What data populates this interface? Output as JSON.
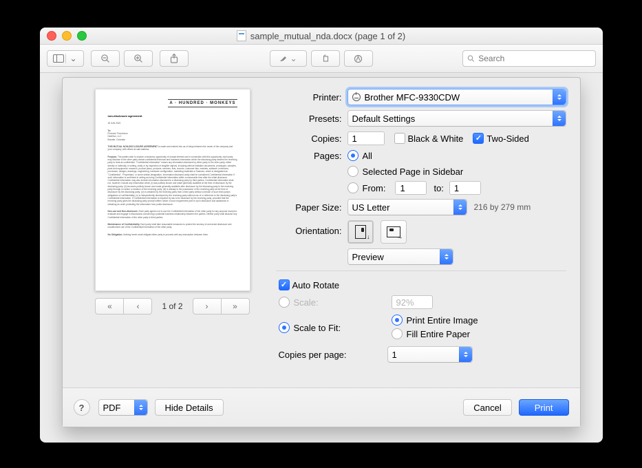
{
  "window": {
    "title": "sample_mutual_nda.docx (page 1 of 2)"
  },
  "toolbar": {
    "search_placeholder": "Search"
  },
  "preview": {
    "page_label": "1 of 2"
  },
  "form": {
    "printer_label": "Printer:",
    "printer_value": "Brother MFC-9330CDW",
    "presets_label": "Presets:",
    "presets_value": "Default Settings",
    "copies_label": "Copies:",
    "copies_value": "1",
    "bw_label": "Black & White",
    "bw_checked": false,
    "twosided_label": "Two-Sided",
    "twosided_checked": true,
    "pages_label": "Pages:",
    "pages_all": "All",
    "pages_selected": "Selected Page in Sidebar",
    "pages_from": "From:",
    "pages_from_value": "1",
    "pages_to": "to:",
    "pages_to_value": "1",
    "pages_mode": "all",
    "paper_size_label": "Paper Size:",
    "paper_size_value": "US Letter",
    "paper_dims": "216 by 279 mm",
    "orientation_label": "Orientation:",
    "orientation": "portrait",
    "section_value": "Preview",
    "auto_rotate_label": "Auto Rotate",
    "auto_rotate_checked": true,
    "scale_label": "Scale:",
    "scale_value": "92%",
    "scaletofit_label": "Scale to Fit:",
    "scale_mode": "fit",
    "print_entire": "Print Entire Image",
    "fill_paper": "Fill Entire Paper",
    "fit_mode": "print_entire",
    "copies_per_page_label": "Copies per page:",
    "copies_per_page_value": "1"
  },
  "footer": {
    "pdf_label": "PDF",
    "hide_details": "Hide Details",
    "cancel": "Cancel",
    "print": "Print"
  }
}
